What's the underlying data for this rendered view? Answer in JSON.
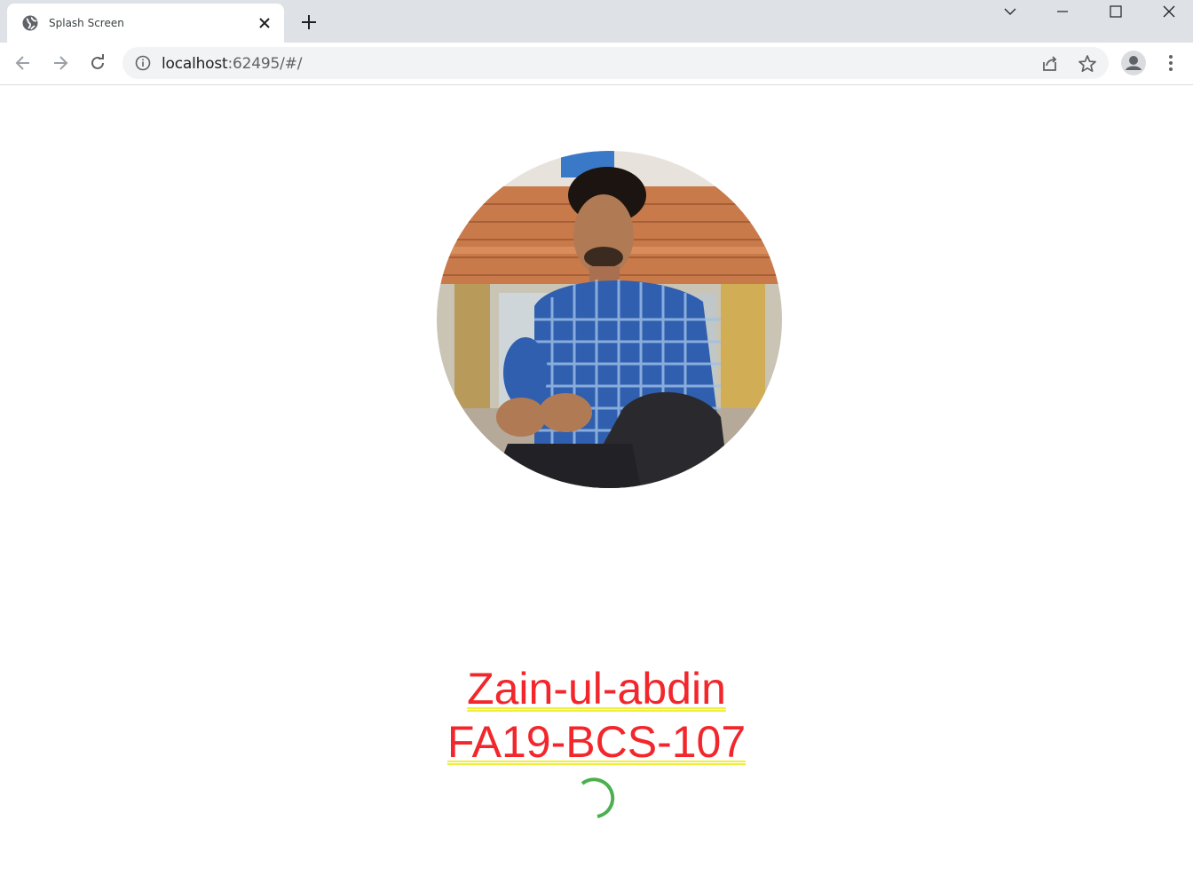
{
  "browser": {
    "tab_title": "Splash Screen",
    "url_host": "localhost",
    "url_rest": ":62495/#/"
  },
  "icons": {
    "favicon": "globe-icon",
    "tab_close": "close-icon",
    "new_tab": "plus-icon",
    "tab_search": "chevron-down-icon",
    "minimize": "minimize-icon",
    "maximize": "maximize-icon",
    "close_window": "close-icon",
    "back": "back-arrow-icon",
    "forward": "forward-arrow-icon",
    "reload": "reload-icon",
    "site_info": "info-icon",
    "share": "share-icon",
    "bookmark": "star-icon",
    "profile": "profile-icon",
    "menu": "kebab-menu-icon"
  },
  "splash": {
    "name": "Zain-ul-abdin",
    "roll_number": "FA19-BCS-107",
    "spinner_color": "#4caf50",
    "text_color": "#f2262b",
    "underline_color": "#f2ef3a"
  }
}
